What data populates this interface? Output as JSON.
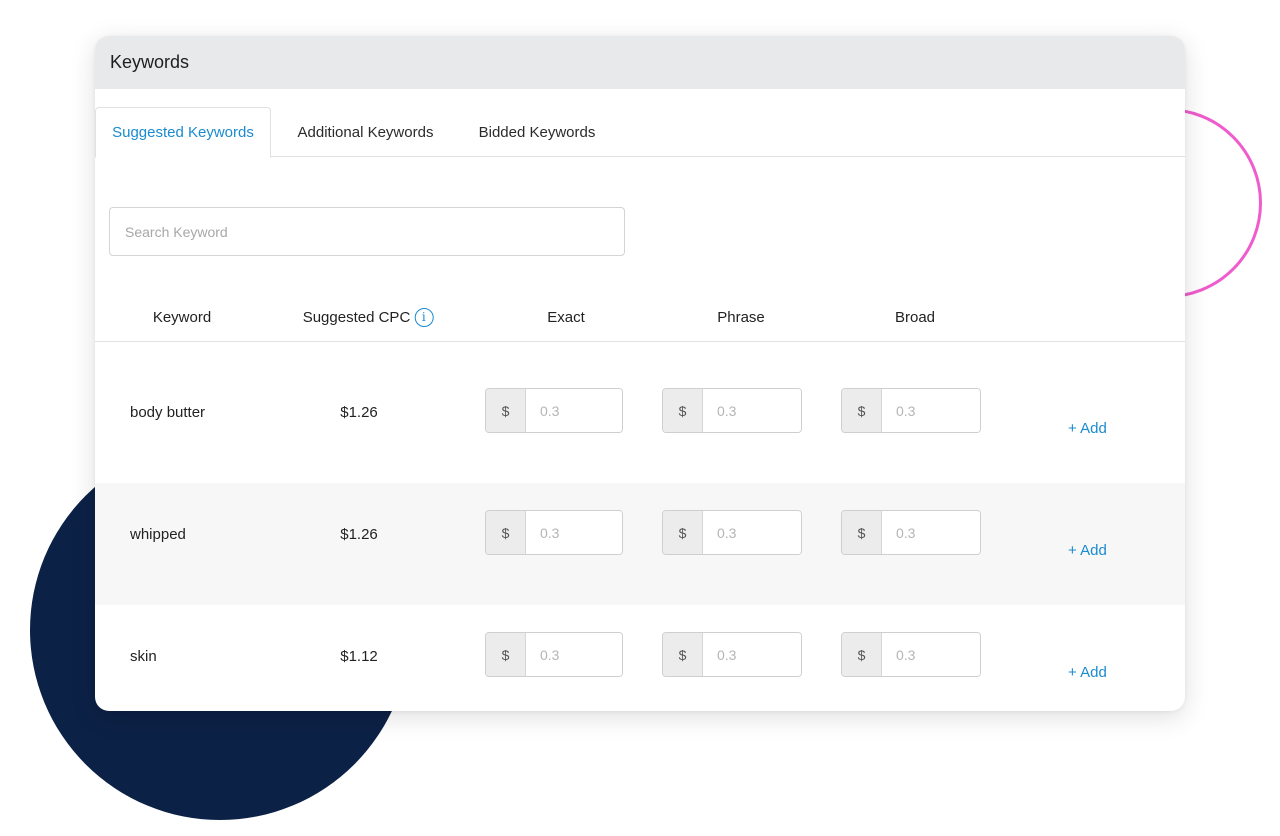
{
  "card": {
    "title": "Keywords"
  },
  "tabs": [
    {
      "label": "Suggested Keywords",
      "active": true
    },
    {
      "label": "Additional Keywords",
      "active": false
    },
    {
      "label": "Bidded Keywords",
      "active": false
    }
  ],
  "search": {
    "placeholder": "Search Keyword",
    "value": ""
  },
  "columns": {
    "keyword": "Keyword",
    "suggested_cpc": "Suggested CPC",
    "exact": "Exact",
    "phrase": "Phrase",
    "broad": "Broad"
  },
  "currency_symbol": "$",
  "rows": [
    {
      "keyword": "body butter",
      "cpc": "$1.26",
      "exact": "0.3",
      "phrase": "0.3",
      "broad": "0.3",
      "action": "+ Add"
    },
    {
      "keyword": "whipped",
      "cpc": "$1.26",
      "exact": "0.3",
      "phrase": "0.3",
      "broad": "0.3",
      "action": "+ Add"
    },
    {
      "keyword": "skin",
      "cpc": "$1.12",
      "exact": "0.3",
      "phrase": "0.3",
      "broad": "0.3",
      "action": "+ Add"
    }
  ],
  "icons": {
    "info": "info-icon"
  },
  "colors": {
    "accent": "#1a8bcf",
    "header_bg": "#e8e9eb",
    "navy_decoration": "#0c2146",
    "pink_decoration": "#ef5ccd"
  }
}
